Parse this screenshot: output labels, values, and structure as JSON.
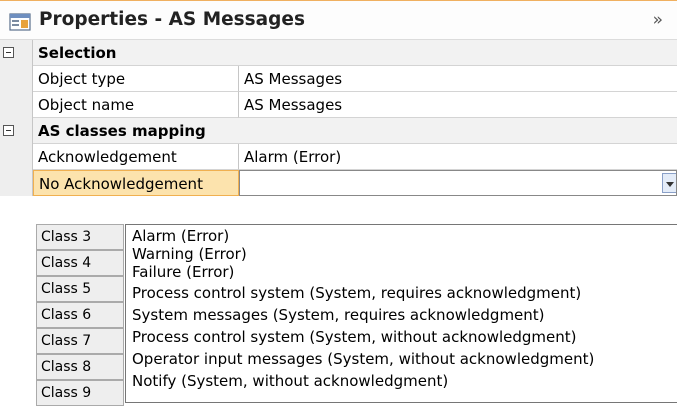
{
  "panel": {
    "title": "Properties - AS Messages",
    "collapse_glyph": "»"
  },
  "selection": {
    "header": "Selection",
    "rows": [
      {
        "name": "Object type",
        "value": "AS Messages"
      },
      {
        "name": "Object name",
        "value": "AS Messages"
      }
    ]
  },
  "mapping": {
    "header": "AS classes mapping",
    "rows": [
      {
        "name": "Acknowledgement",
        "value": "Alarm (Error)"
      },
      {
        "name": "No Acknowledgement",
        "value": ""
      }
    ]
  },
  "class_rows": [
    "Class 3",
    "Class 4",
    "Class 5",
    "Class 6",
    "Class 7",
    "Class 8",
    "Class 9"
  ],
  "dropdown_options": [
    "Alarm (Error)",
    "Warning (Error)",
    "Failure (Error)",
    "Process control system (System, requires acknowledgment)",
    "System messages (System, requires acknowledgment)",
    "Process control system (System, without acknowledgment)",
    "Operator input messages (System, without acknowledgment)",
    "Notify (System, without acknowledgment)"
  ],
  "colors": {
    "selected_cell_bg": "#fce3ad",
    "selected_cell_border": "#f0b050",
    "category_bg": "#f2f2f2"
  }
}
